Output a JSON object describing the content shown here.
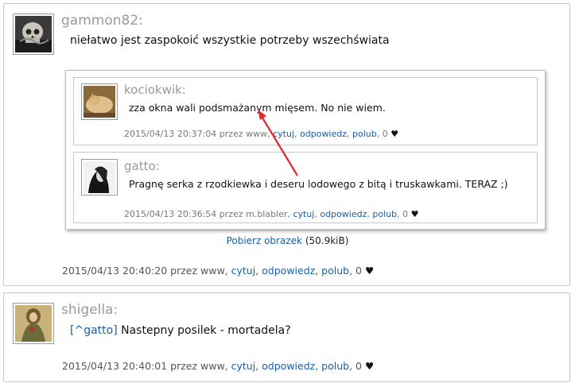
{
  "post1": {
    "author": "gammon82:",
    "text": "niełatwo jest zaspokoić wszystkie potrzeby wszechświata",
    "embedded": {
      "comments": [
        {
          "author": "kociokwik:",
          "text": "zza okna wali podsmażanym mięsem. No nie wiem.",
          "meta_prefix": "2015/04/13 20:37:04 przez www, ",
          "quote": "cytuj",
          "reply": "odpowiedz",
          "like": "polub",
          "likes": "0"
        },
        {
          "author": "gatto:",
          "text": "Pragnę serka z rzodkiewka i deseru lodowego z bitą i truskawkami. TERAZ ;)",
          "meta_prefix": "2015/04/13 20:36:54 przez m.blabler, ",
          "quote": "cytuj",
          "reply": "odpowiedz",
          "like": "polub",
          "likes": "0"
        }
      ]
    },
    "download_label": "Pobierz obrazek",
    "download_size": "(50.9kiB)",
    "meta_prefix": "2015/04/13 20:40:20 przez www, ",
    "quote": "cytuj",
    "reply": "odpowiedz",
    "like": "polub",
    "likes": "0"
  },
  "post2": {
    "author": "shigella:",
    "mention": "[^gatto]",
    "text": "Nastepny posilek - mortadela?",
    "meta_prefix": "2015/04/13 20:40:01 przez www, ",
    "quote": "cytuj",
    "reply": "odpowiedz",
    "like": "polub",
    "likes": "0"
  },
  "glyphs": {
    "heart": "♥",
    "sep": ", "
  },
  "colors": {
    "link": "#1a5fa8",
    "author": "#9a9a9a",
    "arrow": "#e0282e"
  }
}
